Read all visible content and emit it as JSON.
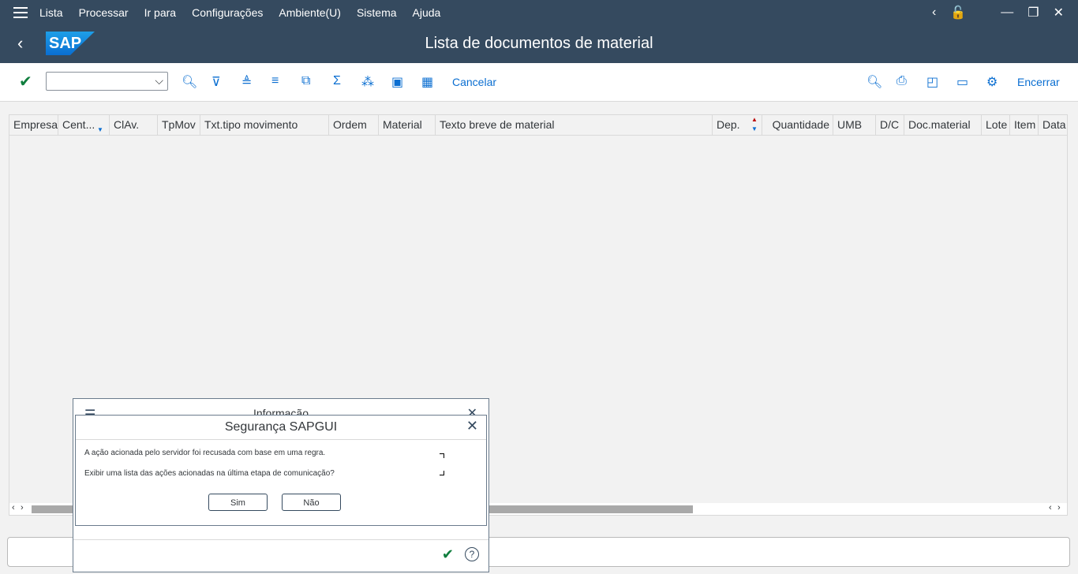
{
  "menubar": {
    "items": [
      "Lista",
      "Processar",
      "Ir para",
      "Configurações",
      "Ambiente(U)",
      "Sistema",
      "Ajuda"
    ]
  },
  "titlebar": {
    "logo_text": "SAP",
    "title": "Lista de documentos de material"
  },
  "toolbar": {
    "command_value": "",
    "cancel_label": "Cancelar",
    "exit_label": "Encerrar"
  },
  "grid": {
    "columns": [
      "Empresa",
      "Cent...",
      "ClAv.",
      "TpMov",
      "Txt.tipo movimento",
      "Ordem",
      "Material",
      "Texto breve de material",
      "Dep.",
      "Quantidade",
      "UMB",
      "D/C",
      "Doc.material",
      "Lote",
      "Item",
      "Data"
    ]
  },
  "popup_bg": {
    "title": "Informação"
  },
  "dialog": {
    "title": "Segurança SAPGUI",
    "message1": "A ação acionada pelo servidor foi recusada com base em uma regra.",
    "message2": "Exibir uma lista das ações acionadas na última etapa de comunicação?",
    "yes_label": "Sim",
    "no_label": "Não"
  },
  "colors": {
    "shell": "#354a5f",
    "accent": "#0a6ed1",
    "positive": "#107e3e"
  }
}
